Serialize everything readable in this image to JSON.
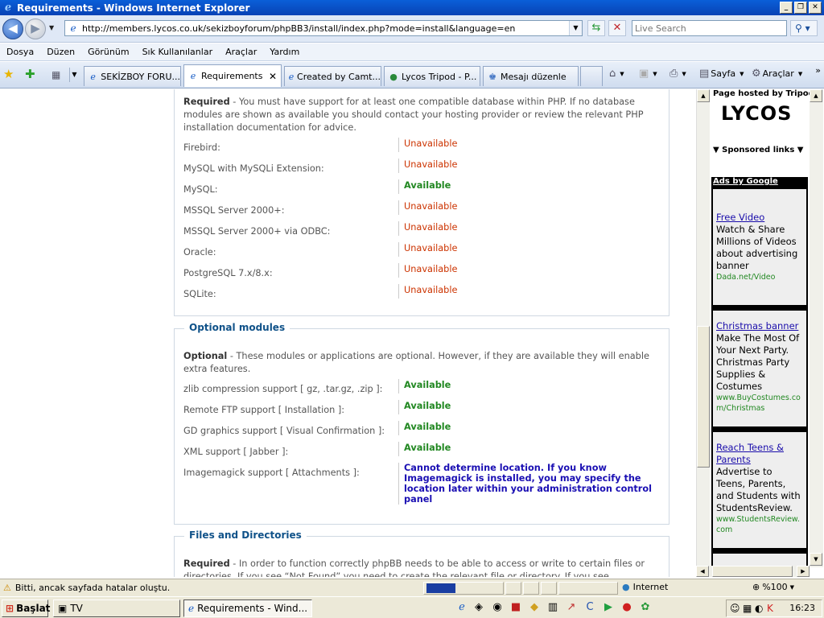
{
  "window": {
    "title": "Requirements - Windows Internet Explorer"
  },
  "address": {
    "url": "http://members.lycos.co.uk/sekizboyforum/phpBB3/install/index.php?mode=install&language=en"
  },
  "search": {
    "placeholder": "Live Search"
  },
  "menu": [
    "Dosya",
    "Düzen",
    "Görünüm",
    "Sık Kullanılanlar",
    "Araçlar",
    "Yardım"
  ],
  "tabs": [
    {
      "label": "SEKİZBOY FORU..."
    },
    {
      "label": "Requirements"
    },
    {
      "label": "Created by Camt..."
    },
    {
      "label": "Lycos Tripod - P..."
    },
    {
      "label": "Mesajı düzenle"
    }
  ],
  "toolbar": {
    "page": "Sayfa",
    "tools": "Araçlar"
  },
  "db": {
    "required_label": "Required",
    "required_text": " - You must have support for at least one compatible database within PHP. If no database modules are shown as available you should contact your hosting provider or review the relevant PHP installation documentation for advice.",
    "rows": [
      {
        "name": "Firebird:",
        "status": "Unavailable"
      },
      {
        "name": "MySQL with MySQLi Extension:",
        "status": "Unavailable"
      },
      {
        "name": "MySQL:",
        "status": "Available"
      },
      {
        "name": "MSSQL Server 2000+:",
        "status": "Unavailable"
      },
      {
        "name": "MSSQL Server 2000+ via ODBC:",
        "status": "Unavailable"
      },
      {
        "name": "Oracle:",
        "status": "Unavailable"
      },
      {
        "name": "PostgreSQL 7.x/8.x:",
        "status": "Unavailable"
      },
      {
        "name": "SQLite:",
        "status": "Unavailable"
      }
    ]
  },
  "optional": {
    "legend": "Optional modules",
    "label": "Optional",
    "text": " - These modules or applications are optional. However, if they are available they will enable extra features.",
    "rows": [
      {
        "name": "zlib compression support [ gz, .tar.gz, .zip ]:",
        "status": "Available"
      },
      {
        "name": "Remote FTP support [ Installation ]:",
        "status": "Available"
      },
      {
        "name": "GD graphics support [ Visual Confirmation ]:",
        "status": "Available"
      },
      {
        "name": "XML support [ Jabber ]:",
        "status": "Available"
      },
      {
        "name": "Imagemagick support [ Attachments ]:",
        "status": "Cannot determine location. If you know Imagemagick is installed, you may specify the location later within your administration control panel"
      }
    ]
  },
  "files": {
    "legend": "Files and Directories",
    "label": "Required",
    "text": " - In order to function correctly phpBB needs to be able to access or write to certain files or directories. If you see “Not Found” you need to create the relevant file or directory. If you see"
  },
  "sidebar": {
    "hosted": "Page hosted by Tripod",
    "logo": "LYCOS",
    "sponsored": "Sponsored links",
    "ads_by": "Ads by Google",
    "ads": [
      {
        "title": "Free Video",
        "body": "Watch & Share Millions of Videos about advertising banner",
        "url": "Dada.net/Video"
      },
      {
        "title": "Christmas banner",
        "body": "Make The Most Of Your Next Party. Christmas Party Supplies & Costumes",
        "url": "www.BuyCostumes.com/Christmas"
      },
      {
        "title": "Reach Teens & Parents",
        "body": "Advertise to Teens, Parents, and Students with StudentsReview.",
        "url": "www.StudentsReview.com"
      }
    ]
  },
  "status": {
    "text": "Bitti, ancak sayfada hatalar oluştu.",
    "zone": "Internet",
    "zoom": "%100"
  },
  "taskbar": {
    "start": "Başlat",
    "tasks": [
      "TV",
      "Requirements - Wind..."
    ],
    "clock": "16:23"
  },
  "colors": {
    "available": "#228822",
    "unavailable": "#cc3300",
    "heading": "#105289",
    "note": "#1a0fb3"
  }
}
